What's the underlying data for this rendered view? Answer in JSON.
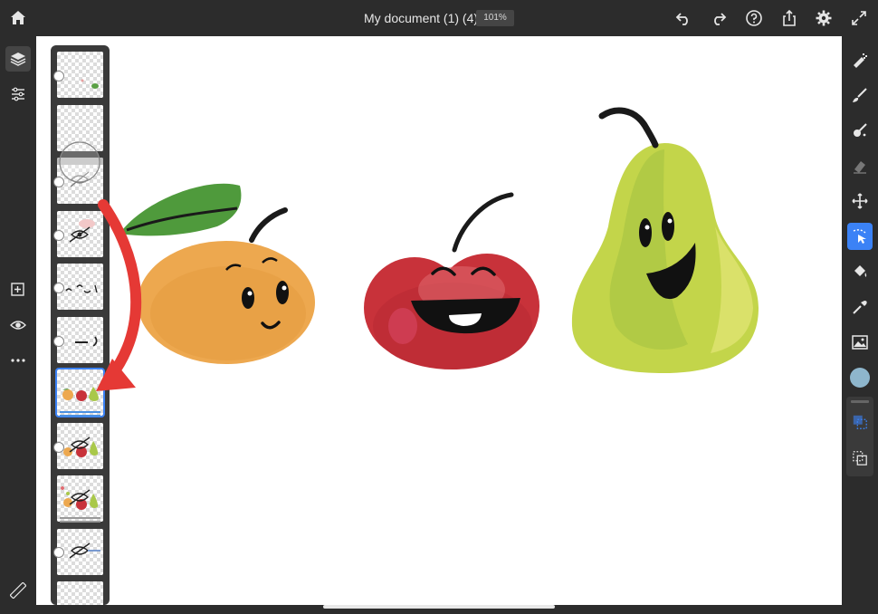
{
  "header": {
    "title": "My document (1) (4)",
    "zoom": "101%"
  },
  "icons": {
    "top": [
      "home-icon",
      "undo-icon",
      "redo-icon",
      "help-icon",
      "share-icon",
      "gear-icon",
      "fullscreen-icon"
    ],
    "left": [
      "layers-icon",
      "adjustments-icon",
      "add-layer-icon",
      "visibility-icon",
      "more-icon",
      "ruler-icon"
    ],
    "right": [
      "pixel-brush-icon",
      "live-brush-icon",
      "vector-brush-icon",
      "eraser-icon",
      "move-icon",
      "selection-icon",
      "fill-icon",
      "eyedropper-icon",
      "image-icon",
      "color-swatch",
      "mask-icon",
      "transform-icon"
    ]
  },
  "colors": {
    "accent": "#3b82f6",
    "swatch": "#8eb6cc",
    "arrow": "#e53935"
  },
  "layers": {
    "count": 11,
    "selected_index": 6
  }
}
